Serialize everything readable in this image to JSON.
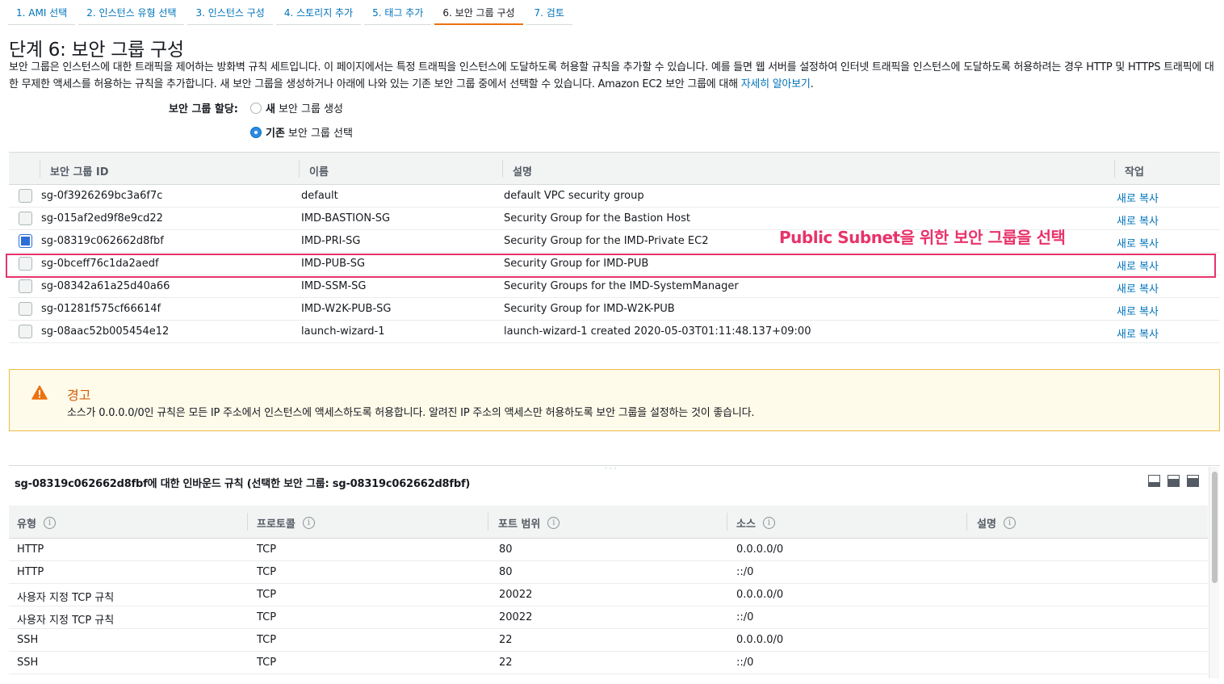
{
  "tabs": [
    {
      "label": "1. AMI 선택"
    },
    {
      "label": "2. 인스턴스 유형 선택"
    },
    {
      "label": "3. 인스턴스 구성"
    },
    {
      "label": "4. 스토리지 추가"
    },
    {
      "label": "5. 태그 추가"
    },
    {
      "label": "6. 보안 그룹 구성"
    },
    {
      "label": "7. 검토"
    }
  ],
  "active_tab_index": 5,
  "page": {
    "title": "단계 6: 보안 그룹 구성",
    "description_part1": "보안 그룹은 인스턴스에 대한 트래픽을 제어하는 방화벽 규칙 세트입니다. 이 페이지에서는 특정 트래픽을 인스턴스에 도달하도록 허용할 규칙을 추가할 수 있습니다. 예를 들면 웹 서버를 설정하여 인터넷 트래픽을 인스턴스에 도달하도록 허용하려는 경우 HTTP 및 HTTPS 트래픽에 대한 무제한 액세스를 허용하는 규칙을 추가합니다. 새 보안 그룹을 생성하거나 아래에 나와 있는 기존 보안 그룹 중에서 선택할 수 있습니다. Amazon EC2 보안 그룹에 대해 ",
    "learn_more_link": "자세히 알아보기",
    "description_end": "."
  },
  "assign": {
    "label": "보안 그룹 할당:",
    "option_new_bold": "새",
    "option_new_rest": "보안 그룹 생성",
    "option_existing_bold": "기존",
    "option_existing_rest": "보안 그룹 선택",
    "selected": "existing"
  },
  "sg_table": {
    "headers": {
      "id": "보안 그룹 ID",
      "name": "이름",
      "description": "설명",
      "actions": "작업"
    },
    "rows": [
      {
        "id": "sg-0f3926269bc3a6f7c",
        "name": "default",
        "description": "default VPC security group",
        "action": "새로 복사",
        "checked": false
      },
      {
        "id": "sg-015af2ed9f8e9cd22",
        "name": "IMD-BASTION-SG",
        "description": "Security Group for the Bastion Host",
        "action": "새로 복사",
        "checked": false
      },
      {
        "id": "sg-08319c062662d8fbf",
        "name": "IMD-PRI-SG",
        "description": "Security Group for the IMD-Private EC2",
        "action": "새로 복사",
        "checked": true
      },
      {
        "id": "sg-0bceff76c1da2aedf",
        "name": "IMD-PUB-SG",
        "description": "Security Group for IMD-PUB",
        "action": "새로 복사",
        "checked": false
      },
      {
        "id": "sg-08342a61a25d40a66",
        "name": "IMD-SSM-SG",
        "description": "Security Groups for the IMD-SystemManager",
        "action": "새로 복사",
        "checked": false
      },
      {
        "id": "sg-01281f575cf66614f",
        "name": "IMD-W2K-PUB-SG",
        "description": "Security Group for IMD-W2K-PUB",
        "action": "새로 복사",
        "checked": false
      },
      {
        "id": "sg-08aac52b005454e12",
        "name": "launch-wizard-1",
        "description": "launch-wizard-1 created 2020-05-03T01:11:48.137+09:00",
        "action": "새로 복사",
        "checked": false
      }
    ]
  },
  "annotation": {
    "text": "Public Subnet을 위한 보안 그룹을 선택",
    "color": "#e8336b"
  },
  "warning": {
    "title": "경고",
    "text": "소스가 0.0.0.0/0인 규칙은 모든 IP 주소에서 인스턴스에 액세스하도록 허용합니다. 알려진 IP 주소의 액세스만 허용하도록 보안 그룹을 설정하는 것이 좋습니다."
  },
  "inbound": {
    "title": "sg-08319c062662d8fbf에 대한 인바운드 규칙 (선택한 보안 그룹: sg-08319c062662d8fbf)",
    "headers": {
      "type": "유형",
      "protocol": "프로토콜",
      "port": "포트 범위",
      "source": "소스",
      "description": "설명"
    },
    "rows": [
      {
        "type": "HTTP",
        "protocol": "TCP",
        "port": "80",
        "source": "0.0.0.0/0"
      },
      {
        "type": "HTTP",
        "protocol": "TCP",
        "port": "80",
        "source": "::/0"
      },
      {
        "type": "사용자 지정 TCP 규칙",
        "protocol": "TCP",
        "port": "20022",
        "source": "0.0.0.0/0"
      },
      {
        "type": "사용자 지정 TCP 규칙",
        "protocol": "TCP",
        "port": "20022",
        "source": "::/0"
      },
      {
        "type": "SSH",
        "protocol": "TCP",
        "port": "22",
        "source": "0.0.0.0/0"
      },
      {
        "type": "SSH",
        "protocol": "TCP",
        "port": "22",
        "source": "::/0"
      }
    ]
  },
  "colors": {
    "link": "#0073bb",
    "accent": "#ec7211",
    "warning_title": "#d45b07",
    "highlight": "#e8336b"
  },
  "icons": {
    "warning": "warning-triangle-icon",
    "info": "info-icon"
  }
}
